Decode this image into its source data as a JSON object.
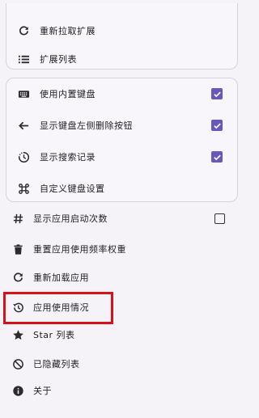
{
  "colors": {
    "background": "#f5f3f7",
    "group_border": "#d5d2da",
    "checkbox_checked": "#6a56c0",
    "highlight_box": "#d3121a"
  },
  "group_top": {
    "items": [
      {
        "icon": "refresh-icon",
        "label": "重新拉取扩展"
      },
      {
        "icon": "list-icon",
        "label": "扩展列表"
      }
    ]
  },
  "group_keyboard": {
    "items": [
      {
        "icon": "keyboard-icon",
        "label": "使用内置键盘",
        "checked": true
      },
      {
        "icon": "arrow-left-icon",
        "label": "显示键盘左侧删除按钮",
        "checked": true
      },
      {
        "icon": "history-dotted-icon",
        "label": "显示搜索记录",
        "checked": true
      },
      {
        "icon": "command-icon",
        "label": "自定义键盘设置"
      }
    ]
  },
  "main": {
    "items": [
      {
        "icon": "hash-icon",
        "label": "显示应用启动次数",
        "checked": false
      },
      {
        "icon": "trash-icon",
        "label": "重置应用使用频率权重"
      },
      {
        "icon": "refresh-icon",
        "label": "重新加载应用"
      },
      {
        "icon": "history-icon",
        "label": "应用使用情况"
      },
      {
        "icon": "star-icon",
        "label": "Star 列表"
      },
      {
        "icon": "hidden-icon",
        "label": "已隐藏列表"
      },
      {
        "icon": "info-icon",
        "label": "关于"
      }
    ]
  }
}
